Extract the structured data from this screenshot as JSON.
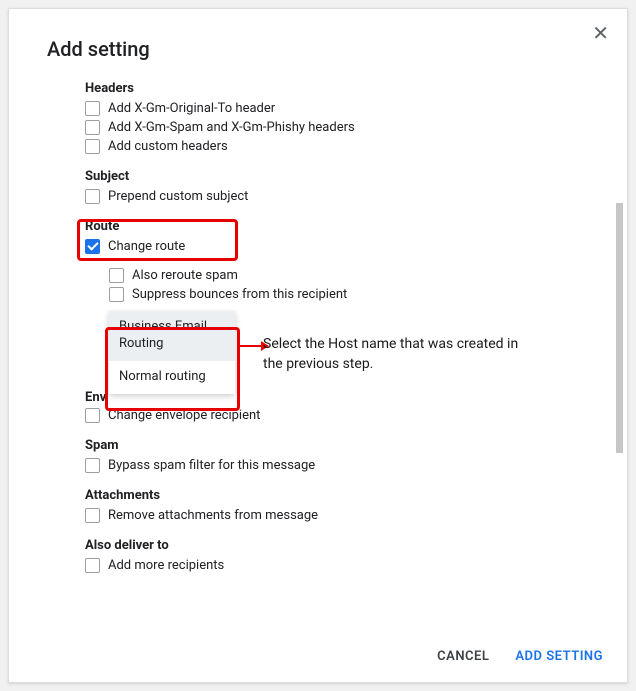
{
  "dialog": {
    "title": "Add setting",
    "close": "✕"
  },
  "sections": {
    "headers": {
      "label": "Headers",
      "add_x_gm_original": "Add X-Gm-Original-To header",
      "add_x_gm_spam": "Add X-Gm-Spam and X-Gm-Phishy headers",
      "add_custom": "Add custom headers"
    },
    "subject": {
      "label": "Subject",
      "prepend": "Prepend custom subject"
    },
    "route": {
      "label": "Route",
      "change_route": "Change route",
      "also_reroute_spam": "Also reroute spam",
      "suppress_bounces": "Suppress bounces from this recipient",
      "dropdown": {
        "business_email": "Business Email Routing",
        "normal_routing": "Normal routing"
      }
    },
    "envelope": {
      "label_part1": "Env",
      "change_recipient": "Change envelope recipient"
    },
    "spam": {
      "label": "Spam",
      "bypass": "Bypass spam filter for this message"
    },
    "attachments": {
      "label": "Attachments",
      "remove": "Remove attachments from message"
    },
    "also_deliver": {
      "label": "Also deliver to",
      "add_more": "Add more recipients"
    }
  },
  "annotation": {
    "text": "Select the Host name that was created in the previous step."
  },
  "footer": {
    "cancel": "CANCEL",
    "add": "ADD SETTING"
  }
}
